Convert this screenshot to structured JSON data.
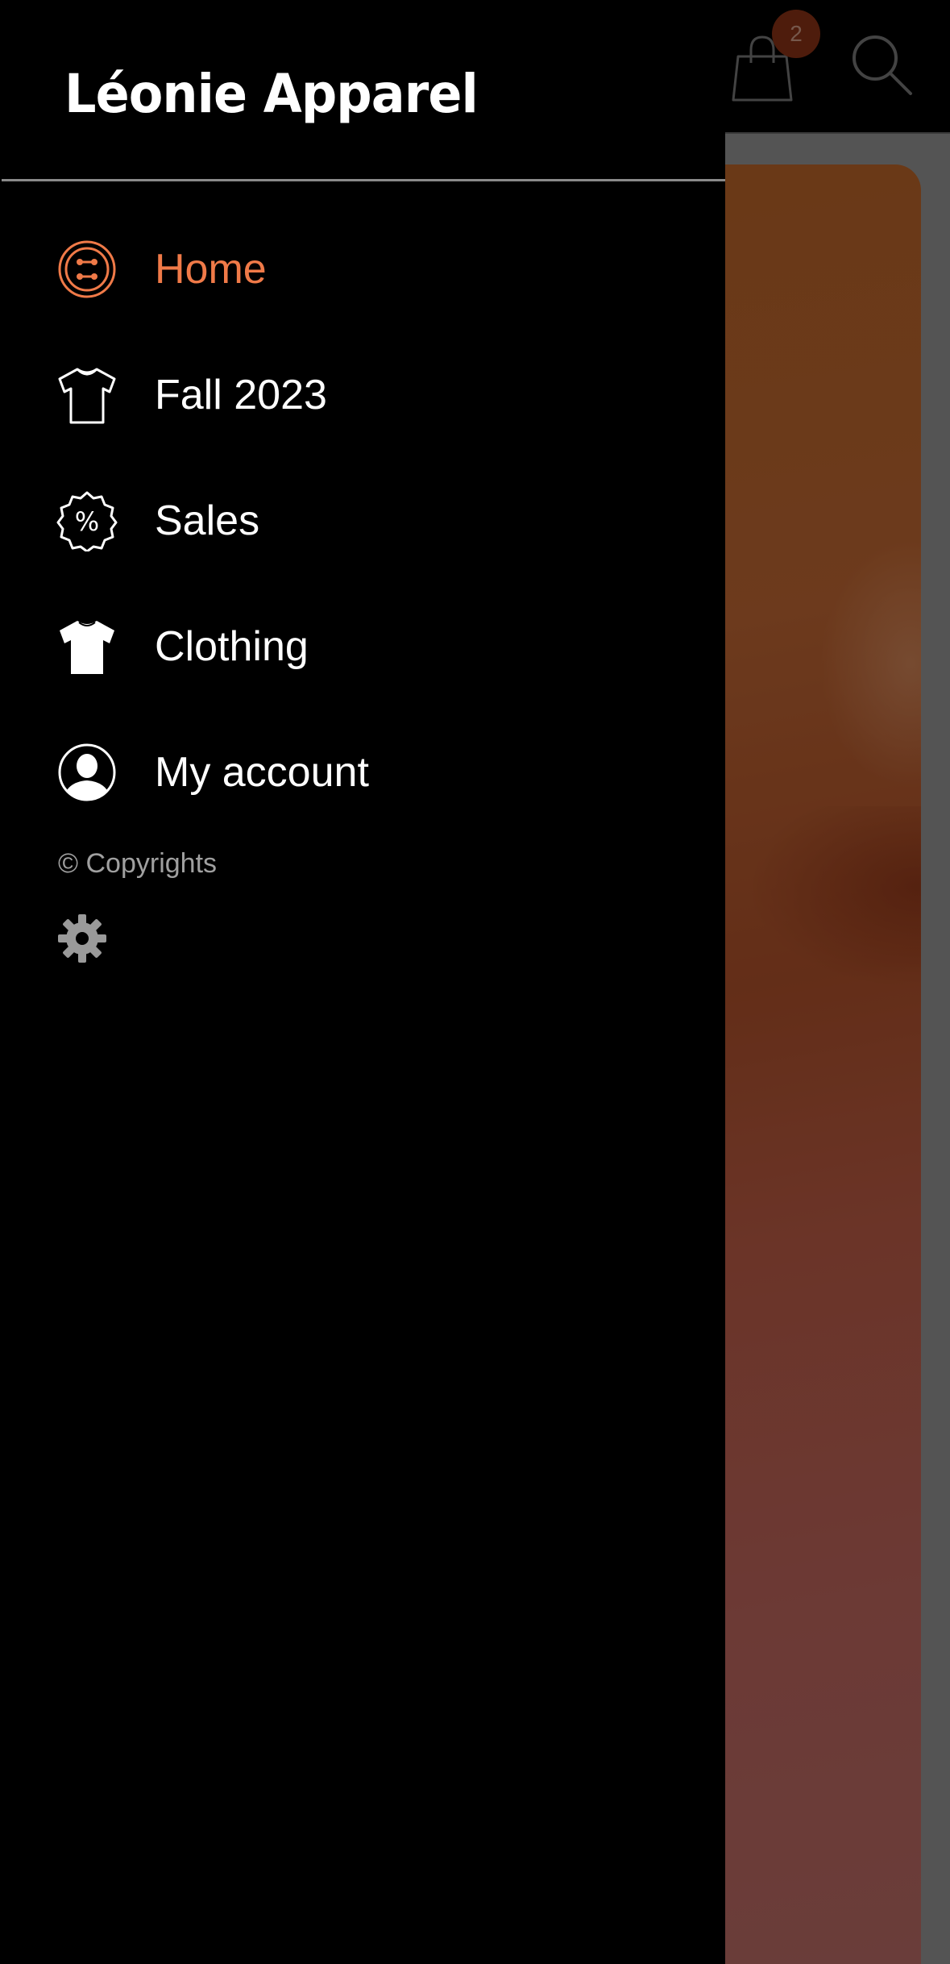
{
  "app": {
    "brand": "Léonie Apparel"
  },
  "header": {
    "cart_count": "2",
    "cart_icon": "shopping-bag-icon",
    "search_icon": "search-icon"
  },
  "drawer": {
    "items": [
      {
        "label": "Home",
        "icon": "button-icon",
        "active": true
      },
      {
        "label": "Fall 2023",
        "icon": "tshirt-outline-icon",
        "active": false
      },
      {
        "label": "Sales",
        "icon": "discount-badge-icon",
        "active": false
      },
      {
        "label": "Clothing",
        "icon": "tshirt-filled-icon",
        "active": false
      },
      {
        "label": "My account",
        "icon": "user-circle-icon",
        "active": false
      }
    ],
    "copyright": "© Copyrights",
    "settings_icon": "gear-icon"
  },
  "colors": {
    "accent": "#f07a48",
    "background": "#000000",
    "text": "#ffffff",
    "muted": "#a0a0a0",
    "badge": "#8e3416"
  }
}
